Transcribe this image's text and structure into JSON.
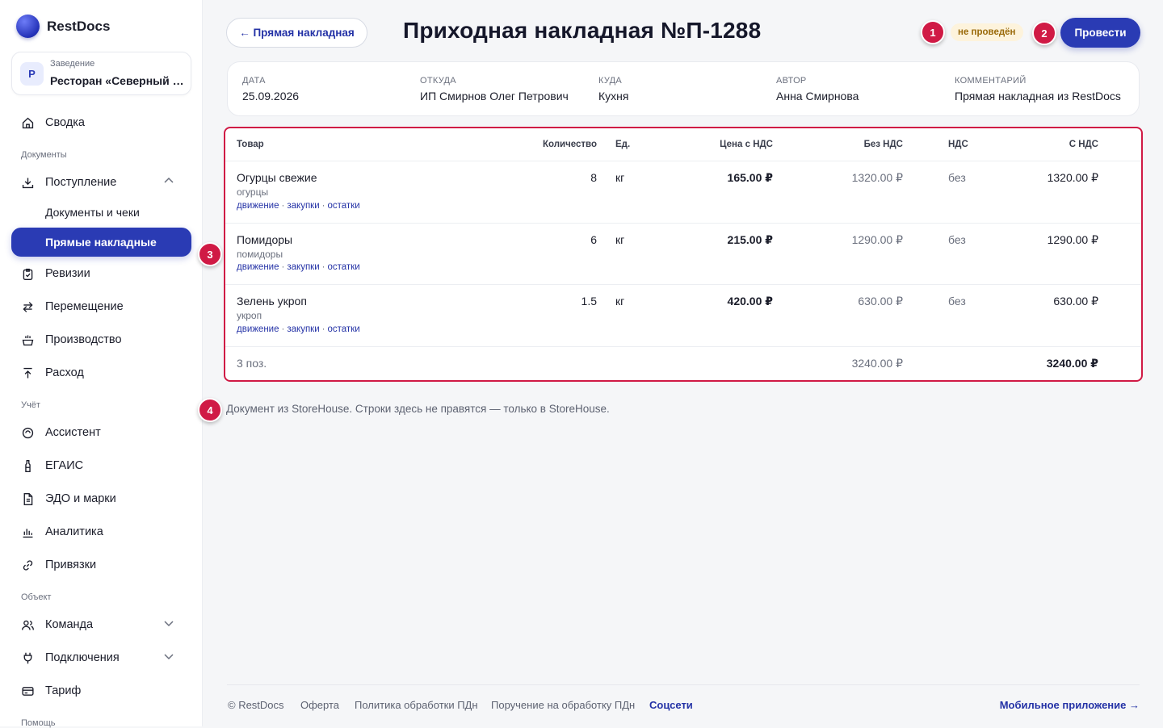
{
  "app": {
    "name": "RestDocs"
  },
  "venue": {
    "caption": "Заведение",
    "avatar": "Р",
    "name": "Ресторан «Северный ветер»"
  },
  "nav": {
    "summary": "Сводка",
    "section_docs": "Документы",
    "receipts": "Поступление",
    "docs_and_checks": "Документы и чеки",
    "direct_invoices": "Прямые накладные",
    "revisions": "Ревизии",
    "transfer": "Перемещение",
    "production": "Производство",
    "expense": "Расход",
    "section_accounting": "Учёт",
    "assistant": "Ассистент",
    "egais": "ЕГАИС",
    "edo": "ЭДО и марки",
    "analytics": "Аналитика",
    "bindings": "Привязки",
    "section_object": "Объект",
    "team": "Команда",
    "connections": "Подключения",
    "tariff": "Тариф",
    "section_help": "Помощь"
  },
  "header": {
    "back_label": "← Прямая накладная",
    "title": "Приходная накладная №П-1288",
    "status": "не проведён",
    "post_label": "Провести"
  },
  "markers": [
    "1",
    "2",
    "3",
    "4"
  ],
  "meta": {
    "date_cap": "ДАТА",
    "date": "25.09.2026",
    "from_cap": "ОТКУДА",
    "from": "ИП Смирнов Олег Петрович",
    "to_cap": "КУДА",
    "to": "Кухня",
    "author_cap": "АВТОР",
    "author": "Анна Смирнова",
    "comment_cap": "КОММЕНТАРИЙ",
    "comment": "Прямая накладная из RestDocs"
  },
  "table": {
    "headers": {
      "item": "Товар",
      "qty": "Количество",
      "unit": "Ед.",
      "price": "Цена с НДС",
      "net": "Без НДС",
      "vat": "НДС",
      "gross": "С НДС"
    },
    "links": {
      "movement": "движение",
      "purchases": "закупки",
      "stock": "остатки",
      "sep": "·"
    },
    "rows": [
      {
        "name": "Огурцы свежие",
        "alias": "огурцы",
        "qty": "8",
        "unit": "кг",
        "price": "165.00 ₽",
        "net": "1320.00 ₽",
        "vat": "без",
        "gross": "1320.00 ₽"
      },
      {
        "name": "Помидоры",
        "alias": "помидоры",
        "qty": "6",
        "unit": "кг",
        "price": "215.00 ₽",
        "net": "1290.00 ₽",
        "vat": "без",
        "gross": "1290.00 ₽"
      },
      {
        "name": "Зелень укроп",
        "alias": "укроп",
        "qty": "1.5",
        "unit": "кг",
        "price": "420.00 ₽",
        "net": "630.00 ₽",
        "vat": "без",
        "gross": "630.00 ₽"
      }
    ],
    "total": {
      "count": "3 поз.",
      "net": "3240.00 ₽",
      "gross": "3240.00 ₽"
    }
  },
  "note": "Документ из StoreHouse. Строки здесь не правятся — только в StoreHouse.",
  "footer": {
    "copyright": "© RestDocs",
    "offer": "Оферта",
    "privacy": "Политика обработки ПДн",
    "instruction": "Поручение на обработку ПДн",
    "social": "Соцсети",
    "mobile": "Мобильное приложение →"
  },
  "colors": {
    "accent": "#2a3bb4",
    "marker": "#d01a45",
    "status_bg": "#fdf3dc",
    "status_text": "#9a6a0a"
  }
}
